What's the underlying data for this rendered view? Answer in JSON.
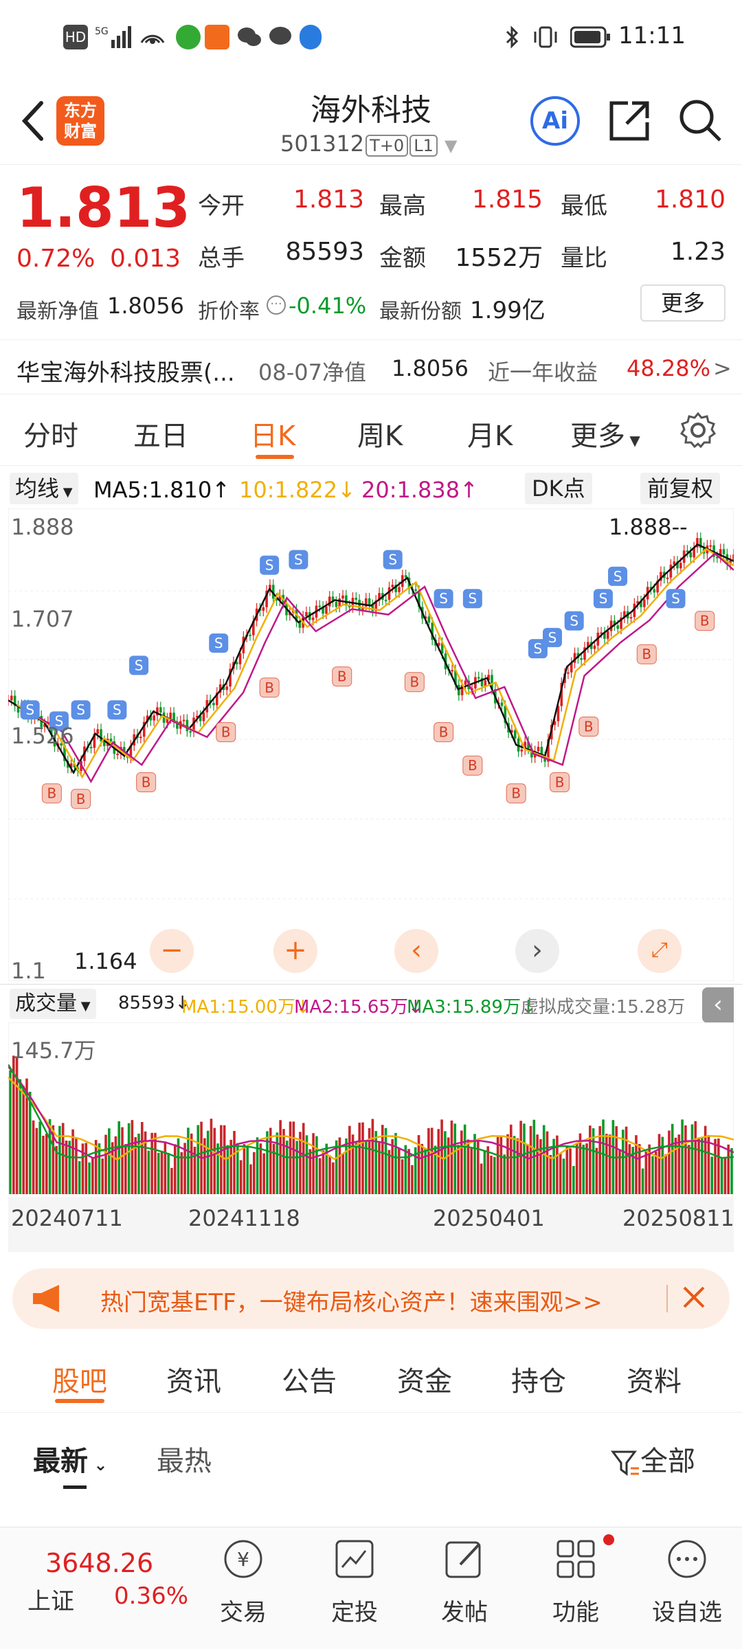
{
  "status_bar": {
    "time": "11:11",
    "hd": "HD",
    "net": "5G"
  },
  "header": {
    "logo": "东方财富",
    "title": "海外科技",
    "code": "501312",
    "tag1": "T+0",
    "tag2": "L1"
  },
  "quote": {
    "price": "1.813",
    "change_pct": "0.72%",
    "change": "0.013",
    "open_label": "今开",
    "open": "1.813",
    "high_label": "最高",
    "high": "1.815",
    "low_label": "最低",
    "low": "1.810",
    "vol_label": "总手",
    "vol": "85593",
    "amount_label": "金额",
    "amount": "1552万",
    "ratio_label": "量比",
    "ratio": "1.23",
    "nav_label": "最新净值",
    "nav": "1.8056",
    "discount_label": "折价率",
    "discount": "-0.41%",
    "shares_label": "最新份额",
    "shares": "1.99亿",
    "more": "更多"
  },
  "fund": {
    "name": "华宝海外科技股票(...",
    "date_label": "08-07净值",
    "nav": "1.8056",
    "yr_label": "近一年收益",
    "yr": "48.28%",
    "arrow": ">"
  },
  "ktabs": [
    "分时",
    "五日",
    "日K",
    "周K",
    "月K",
    "更多"
  ],
  "ma": {
    "btn": "均线",
    "ma5": "MA5:1.810↑",
    "ma10": "10:1.822↓",
    "ma20": "20:1.838↑",
    "dk": "DK点",
    "fq": "前复权"
  },
  "axis": {
    "y1": "1.888",
    "y2": "1.707",
    "y3": "1.526",
    "y4": "1.1",
    "high_mark": "1.888",
    "low_mark": "1.164"
  },
  "volume": {
    "btn": "成交量",
    "v": "85593↓",
    "ma1": "MA1:15.00万↓",
    "ma2": "MA2:15.65万↓",
    "ma3": "MA3:15.89万↓",
    "virt": "虚拟成交量:15.28万",
    "max": "145.7万"
  },
  "dates": [
    "20240711",
    "20241118",
    "20250401",
    "20250811"
  ],
  "banner": {
    "text": "热门宽基ETF，一键布局核心资产！速来围观>>"
  },
  "btabs": [
    "股吧",
    "资讯",
    "公告",
    "资金",
    "持仓",
    "资料"
  ],
  "sort": {
    "latest": "最新",
    "hot": "最热",
    "all": "全部"
  },
  "nav": {
    "index_value": "3648.26",
    "index_name": "上证",
    "index_pct": "0.36%",
    "items": [
      "交易",
      "定投",
      "发帖",
      "功能",
      "设自选"
    ]
  },
  "colors": {
    "up": "#e02020",
    "down": "#0a9a2a",
    "accent": "#f26b1d",
    "ma5": "#111111",
    "ma10": "#f0b000",
    "ma20": "#c0188a"
  }
}
